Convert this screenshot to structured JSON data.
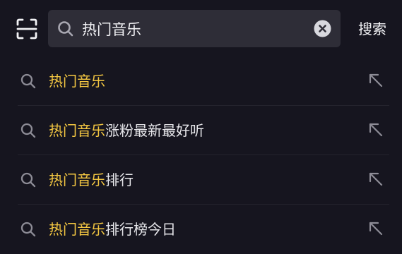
{
  "search": {
    "query": "热门音乐",
    "button_label": "搜索"
  },
  "suggestions": [
    {
      "highlight": "热门音乐",
      "rest": ""
    },
    {
      "highlight": "热门音乐",
      "rest": "涨粉最新最好听"
    },
    {
      "highlight": "热门音乐",
      "rest": "排行"
    },
    {
      "highlight": "热门音乐",
      "rest": "排行榜今日"
    }
  ],
  "colors": {
    "background": "#16151f",
    "search_box": "#2e2d37",
    "highlight": "#f5c842",
    "text": "#e6e6ea",
    "icon": "#9a99a3"
  },
  "icons": {
    "scan": "scan-icon",
    "search": "search-icon",
    "clear": "clear-icon",
    "fill_query": "arrow-up-left-icon"
  }
}
